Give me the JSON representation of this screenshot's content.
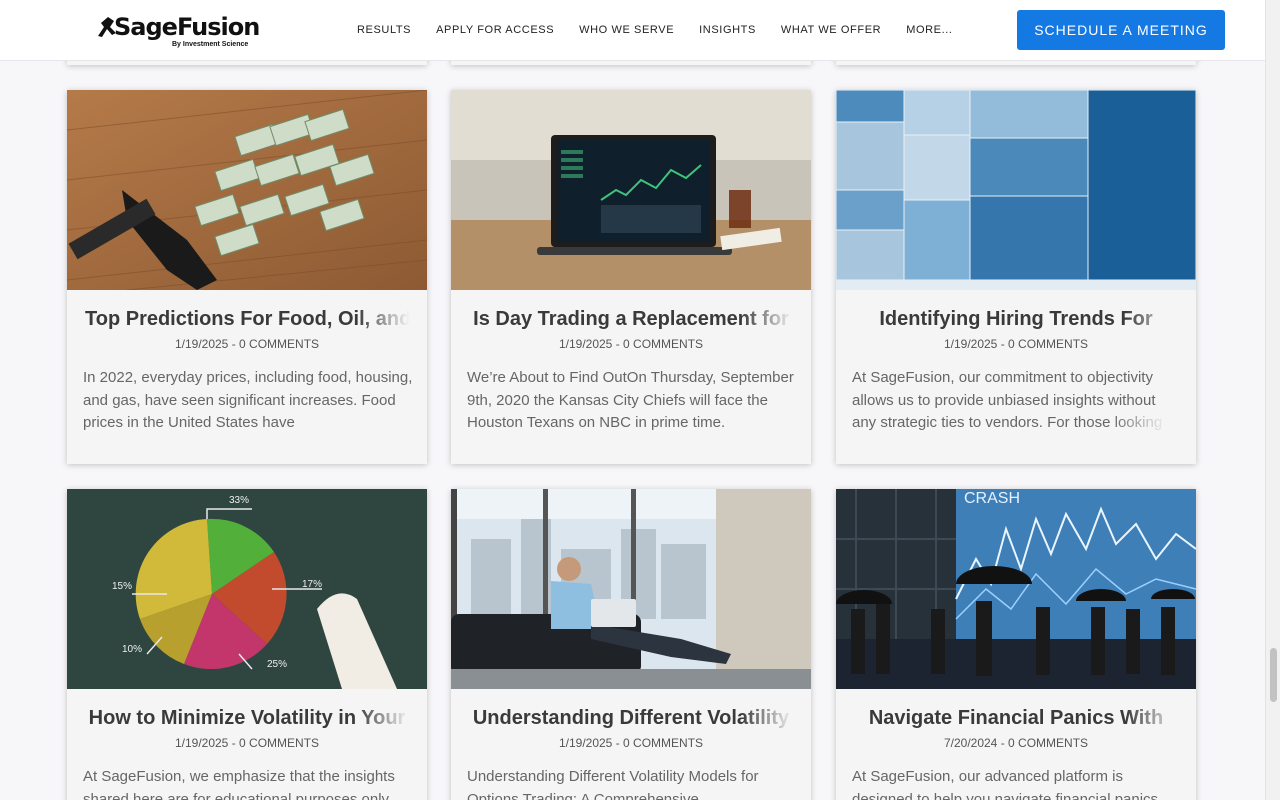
{
  "header": {
    "logo_text": "SageFusion",
    "logo_sub": "By Investment Science",
    "nav": [
      "RESULTS",
      "APPLY FOR ACCESS",
      "WHO WE SERVE",
      "INSIGHTS",
      "WHAT WE OFFER",
      "MORE..."
    ],
    "cta": "SCHEDULE A MEETING"
  },
  "colors": {
    "accent": "#1479e3",
    "card_bg": "#f5f5f5",
    "title": "#3a3a3a"
  },
  "posts": [
    {
      "image": "vacuum-cash-photo",
      "title": "Top Predictions For Food, Oil, and",
      "meta": "1/19/2025 - 0 COMMENTS",
      "excerpt": "In 2022, everyday prices, including food, housing, and gas, have seen significant increases. Food prices in the United States have"
    },
    {
      "image": "laptop-trading-photo",
      "title": "Is Day Trading a Replacement for",
      "meta": "1/19/2025 - 0 COMMENTS",
      "excerpt": "We’re About to Find OutOn Thursday, September 9th, 2020 the Kansas City Chiefs will face the Houston Texans on NBC in prime time."
    },
    {
      "image": "treemap-hiring-photo",
      "title": "Identifying Hiring Trends For",
      "meta": "1/19/2025 - 0 COMMENTS",
      "excerpt": "At SageFusion, our commitment to objectivity allows us to provide unbiased insights without any strategic ties to vendors. For those looking"
    },
    {
      "image": "pie-chalkboard-photo",
      "title": "How to Minimize Volatility in Your",
      "meta": "1/19/2025 - 0 COMMENTS",
      "excerpt": "At SageFusion, we emphasize that the insights shared here are for educational purposes only."
    },
    {
      "image": "man-laptop-couch-photo",
      "title": "Understanding Different Volatility",
      "meta": "1/19/2025 - 0 COMMENTS",
      "excerpt": " Understanding Different Volatility Models for Options Trading: A Comprehensive"
    },
    {
      "image": "crash-umbrellas-photo",
      "title": "Navigate Financial Panics With",
      "meta": "7/20/2024 - 0 COMMENTS",
      "excerpt": "At SageFusion, our advanced platform is designed to help you navigate financial panics"
    }
  ],
  "pie_labels": [
    "33%",
    "17%",
    "15%",
    "10%",
    "25%"
  ],
  "crash_text": "CRASH"
}
